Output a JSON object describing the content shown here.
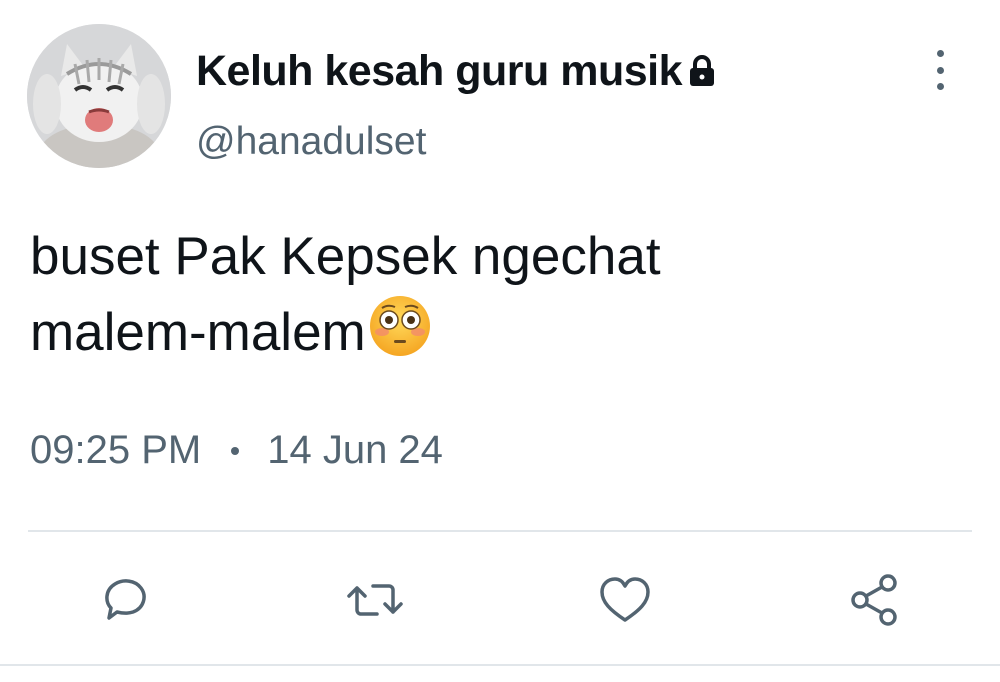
{
  "tweet": {
    "author": {
      "display_name": "Keluh kesah guru musik",
      "handle": "@hanadulset",
      "protected_icon": "lock-icon",
      "avatar_icon": "cat-avatar"
    },
    "text_lines": [
      "buset Pak Kepsek ngechat",
      "malem-malem"
    ],
    "text_emoji": "flushed-face-emoji",
    "time": "09:25 PM",
    "date": "14 Jun 24"
  },
  "actions": {
    "reply": "reply-icon",
    "retweet": "retweet-icon",
    "like": "heart-icon",
    "share": "share-icon",
    "more": "more-options-icon"
  },
  "colors": {
    "text_primary": "#0f1419",
    "text_secondary": "#536471",
    "divider": "#e1e6ea"
  }
}
